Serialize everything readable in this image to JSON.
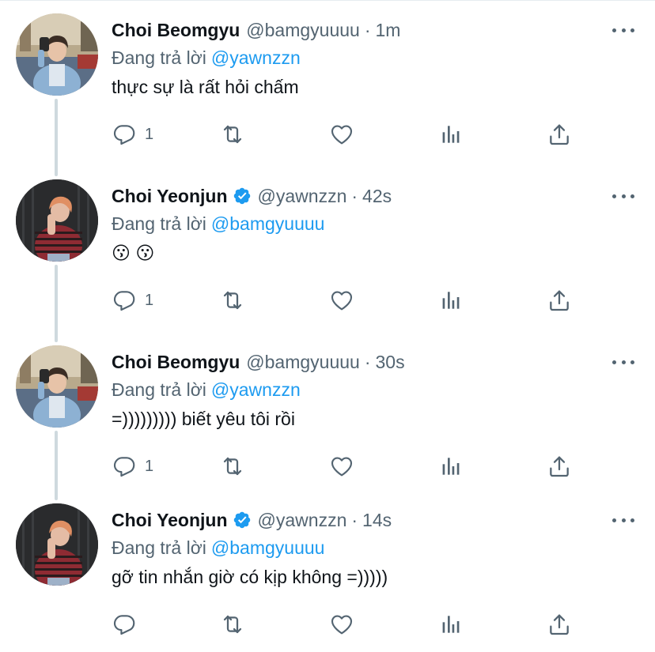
{
  "tweets": [
    {
      "display_name": "Choi Beomgyu",
      "verified": false,
      "handle": "@bamgyuuuu",
      "separator": "·",
      "time": "1m",
      "replying_label": "Đang trả lời",
      "replying_to": "@yawnzzn",
      "text": "thực sự là rất hỏi chấm",
      "reply_count": "1",
      "avatar": "beomgyu"
    },
    {
      "display_name": "Choi Yeonjun",
      "verified": true,
      "handle": "@yawnzzn",
      "separator": "·",
      "time": "42s",
      "replying_label": "Đang trả lời",
      "replying_to": "@bamgyuuuu",
      "text": "😗 😗",
      "reply_count": "1",
      "avatar": "yeonjun"
    },
    {
      "display_name": "Choi Beomgyu",
      "verified": false,
      "handle": "@bamgyuuuu",
      "separator": "·",
      "time": "30s",
      "replying_label": "Đang trả lời",
      "replying_to": "@yawnzzn",
      "text": "=))))))))) biết yêu tôi rồi",
      "reply_count": "1",
      "avatar": "beomgyu"
    },
    {
      "display_name": "Choi Yeonjun",
      "verified": true,
      "handle": "@yawnzzn",
      "separator": "·",
      "time": "14s",
      "replying_label": "Đang trả lời",
      "replying_to": "@bamgyuuuu",
      "text": "gỡ tin nhắn giờ có kịp không =)))))",
      "reply_count": "",
      "avatar": "yeonjun"
    }
  ],
  "icons": {
    "reply": "reply-icon",
    "retweet": "retweet-icon",
    "like": "heart-icon",
    "views": "analytics-icon",
    "share": "share-icon",
    "more": "more-icon",
    "verified": "verified-badge-icon"
  },
  "colors": {
    "accent": "#1d9bf0",
    "muted": "#536471",
    "text": "#0f1419",
    "thread_line": "#cfd9de"
  }
}
